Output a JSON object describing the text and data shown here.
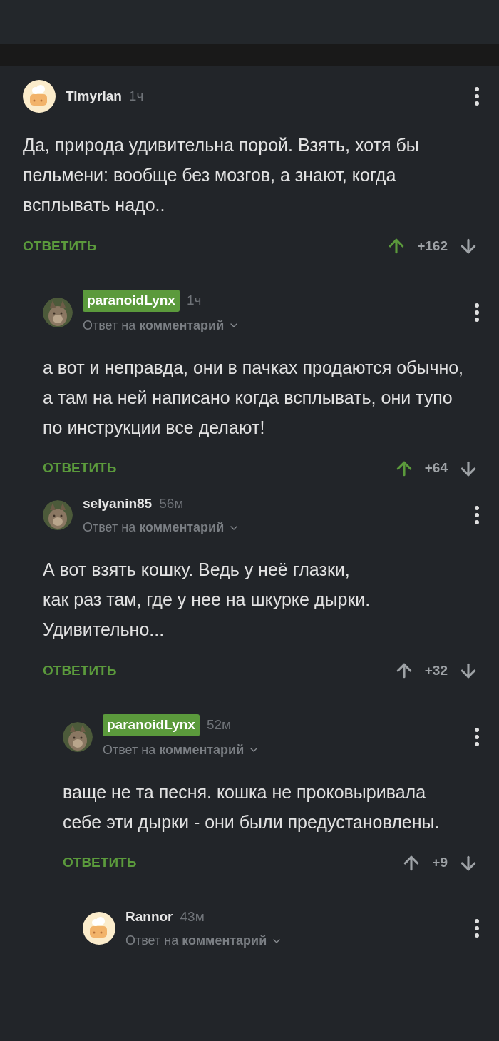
{
  "comments": [
    {
      "author": "Timyrlan",
      "highlighted": false,
      "avatar": {
        "kind": "default"
      },
      "time": "1ч",
      "body": "Да, природа удивительна порой. Взять, хотя бы пельмени: вообще без мозгов, а знают, когда всплывать надо..",
      "reply": "ОТВЕТИТЬ",
      "upvoted": true,
      "score": "+162",
      "children": [
        {
          "author": "paranoidLynx",
          "highlighted": true,
          "avatar": {
            "kind": "picture"
          },
          "time": "1ч",
          "reply_to": "Ответ на **комментарий**",
          "body": "а вот и неправда, они в пачках продаются обычно, а там на ней написано когда всплывать, они тупо по инструкции все делают!",
          "reply": "ОТВЕТИТЬ",
          "upvoted": true,
          "score": "+64"
        },
        {
          "author": "selyanin85",
          "highlighted": false,
          "avatar": {
            "kind": "picture"
          },
          "time": "56м",
          "reply_to": "Ответ на **комментарий**",
          "body": "А вот взять кошку. Ведь у неё глазки,\nкак раз там, где у нее на шкурке дырки. Удивительно...",
          "reply": "ОТВЕТИТЬ",
          "upvoted": false,
          "score": "+32",
          "children": [
            {
              "author": "paranoidLynx",
              "highlighted": true,
              "avatar": {
                "kind": "picture"
              },
              "time": "52м",
              "reply_to": "Ответ на **комментарий**",
              "body": "ваще не та песня. кошка не проковыривала себе эти дырки - они были предустановлены.",
              "reply": "ОТВЕТИТЬ",
              "upvoted": false,
              "score": "+9",
              "children": [
                {
                  "author": "Rannor",
                  "highlighted": false,
                  "avatar": {
                    "kind": "default"
                  },
                  "time": "43м",
                  "reply_to": "Ответ на **комментарий**"
                }
              ]
            }
          ]
        }
      ]
    }
  ]
}
